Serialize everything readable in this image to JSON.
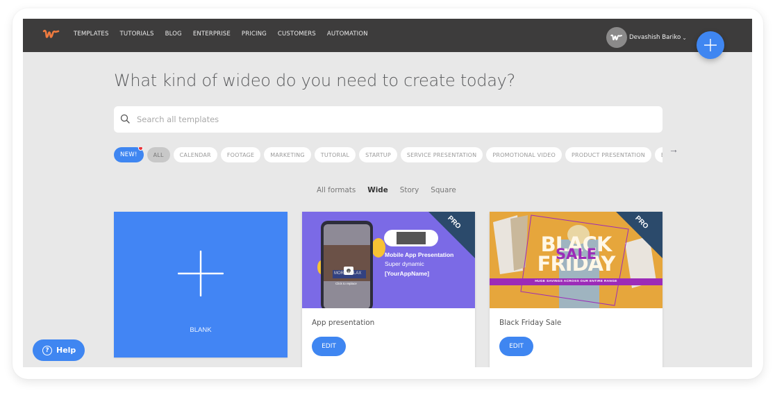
{
  "nav": {
    "logo": "wideo-logo",
    "links": [
      "TEMPLATES",
      "TUTORIALS",
      "BLOG",
      "ENTERPRISE",
      "PRICING",
      "CUSTOMERS",
      "AUTOMATION"
    ],
    "user_name": "Devashish Bariko",
    "user_chevron": "⌄",
    "create_button_icon": "plus-icon"
  },
  "main": {
    "headline": "What kind of wideo do you need to create today?",
    "search": {
      "placeholder": "Search all templates",
      "value": ""
    },
    "chips": [
      "NEW!",
      "ALL",
      "CALENDAR",
      "FOOTAGE",
      "MARKETING",
      "TUTORIAL",
      "STARTUP",
      "SERVICE PRESENTATION",
      "PROMOTIONAL VIDEO",
      "PRODUCT PRESENTATION",
      "E"
    ],
    "chips_arrow": "→",
    "formats": [
      "All formats",
      "Wide",
      "Story",
      "Square"
    ],
    "active_format": "Wide",
    "blank_card": {
      "label": "BLANK"
    },
    "templates": [
      {
        "title": "App presentation",
        "badge": "PRO",
        "edit_label": "EDIT",
        "thumb": {
          "heading": "Mobile App Presentation",
          "line1": "Super dynamic",
          "line2": "[YourAppName]",
          "phone_text": "MORE RELAX",
          "phone_caption": "Click to replace",
          "bg": "#7b6ae6"
        }
      },
      {
        "title": "Black Friday Sale",
        "badge": "PRO",
        "edit_label": "EDIT",
        "thumb": {
          "word1": "BLACK",
          "word2": "SALE",
          "word3": "FRIDAY",
          "banner": "HUGE SAVINGS ACROSS OUR ENTIRE RANGE",
          "bg": "#e6a63c"
        }
      }
    ]
  },
  "help": {
    "label": "Help",
    "icon": "?"
  },
  "colors": {
    "accent": "#3f86f1",
    "nav_bg": "#3d3c3c",
    "page_bg": "#e8e8e8",
    "logo": "#f07b3f"
  }
}
